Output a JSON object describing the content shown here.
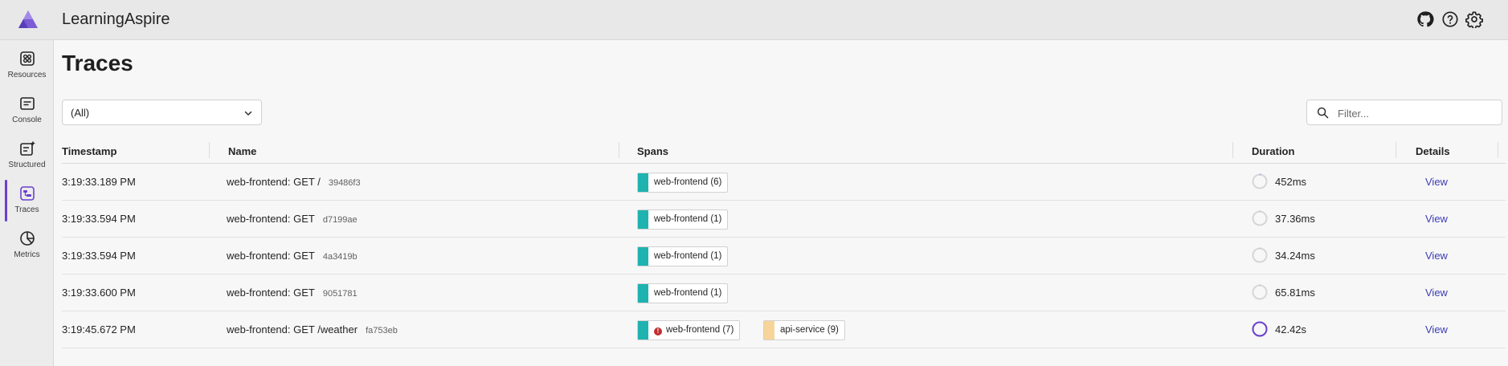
{
  "app": {
    "title": "LearningAspire",
    "header_icons": [
      "github-icon",
      "help-icon",
      "settings-icon"
    ]
  },
  "sidebar": {
    "items": [
      {
        "label": "Resources",
        "icon": "resources-grid-icon",
        "active": false
      },
      {
        "label": "Console",
        "icon": "console-icon",
        "active": false
      },
      {
        "label": "Structured",
        "icon": "structured-logs-icon",
        "active": false
      },
      {
        "label": "Traces",
        "icon": "traces-icon",
        "active": true
      },
      {
        "label": "Metrics",
        "icon": "metrics-icon",
        "active": false
      }
    ]
  },
  "page": {
    "title": "Traces",
    "resource_select": {
      "value": "(All)"
    },
    "filter": {
      "placeholder": "Filter..."
    }
  },
  "table": {
    "headers": {
      "timestamp": "Timestamp",
      "name": "Name",
      "spans": "Spans",
      "duration": "Duration",
      "details": "Details"
    },
    "rows": [
      {
        "timestamp": "3:19:33.189 PM",
        "name": "web-frontend: GET /",
        "trace_id": "39486f3",
        "spans": [
          {
            "label": "web-frontend (6)",
            "color": "#1fb3b0",
            "error": false
          }
        ],
        "duration": "452ms",
        "duration_fraction": 0.01,
        "view": "View"
      },
      {
        "timestamp": "3:19:33.594 PM",
        "name": "web-frontend: GET",
        "trace_id": "d7199ae",
        "spans": [
          {
            "label": "web-frontend (1)",
            "color": "#1fb3b0",
            "error": false
          }
        ],
        "duration": "37.36ms",
        "duration_fraction": 0.001,
        "view": "View"
      },
      {
        "timestamp": "3:19:33.594 PM",
        "name": "web-frontend: GET",
        "trace_id": "4a3419b",
        "spans": [
          {
            "label": "web-frontend (1)",
            "color": "#1fb3b0",
            "error": false
          }
        ],
        "duration": "34.24ms",
        "duration_fraction": 0.001,
        "view": "View"
      },
      {
        "timestamp": "3:19:33.600 PM",
        "name": "web-frontend: GET",
        "trace_id": "9051781",
        "spans": [
          {
            "label": "web-frontend (1)",
            "color": "#1fb3b0",
            "error": false
          }
        ],
        "duration": "65.81ms",
        "duration_fraction": 0.002,
        "view": "View"
      },
      {
        "timestamp": "3:19:45.672 PM",
        "name": "web-frontend: GET /weather",
        "trace_id": "fa753eb",
        "spans": [
          {
            "label": "web-frontend (7)",
            "color": "#1fb3b0",
            "error": true
          },
          {
            "label": "api-service (9)",
            "color": "#f7d59a",
            "error": false
          }
        ],
        "duration": "42.42s",
        "duration_fraction": 1.0,
        "view": "View"
      }
    ]
  },
  "colors": {
    "accent": "#6b3fd1",
    "link": "#3c3cb4",
    "error": "#c22e2e"
  }
}
